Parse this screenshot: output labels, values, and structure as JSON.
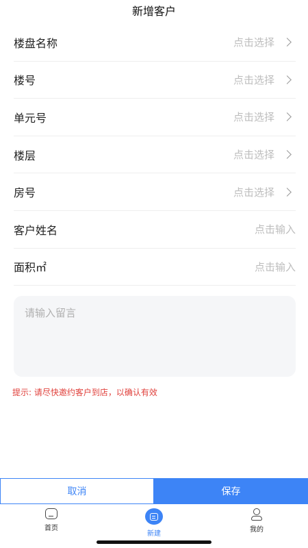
{
  "header": {
    "title": "新增客户"
  },
  "form": {
    "rows": [
      {
        "label": "楼盘名称",
        "value": "点击选择",
        "chevron": true
      },
      {
        "label": "楼号",
        "value": "点击选择",
        "chevron": true
      },
      {
        "label": "单元号",
        "value": "点击选择",
        "chevron": true
      },
      {
        "label": "楼层",
        "value": "点击选择",
        "chevron": true
      },
      {
        "label": "房号",
        "value": "点击选择",
        "chevron": true
      },
      {
        "label": "客户姓名",
        "value": "点击输入",
        "chevron": false
      },
      {
        "label": "面积㎡",
        "value": "点击输入",
        "chevron": false
      }
    ],
    "message_placeholder": "请输入留言"
  },
  "hint": "提示: 请尽快邀约客户到店，以确认有效",
  "actions": {
    "cancel": "取消",
    "save": "保存"
  },
  "tabbar": {
    "items": [
      {
        "label": "首页",
        "icon": "home-icon",
        "active": false
      },
      {
        "label": "新建",
        "icon": "new-icon",
        "active": true
      },
      {
        "label": "我的",
        "icon": "user-icon",
        "active": false
      }
    ]
  },
  "colors": {
    "accent": "#3d84f6",
    "hint": "#e0413c",
    "placeholder": "#bdbdbd"
  }
}
